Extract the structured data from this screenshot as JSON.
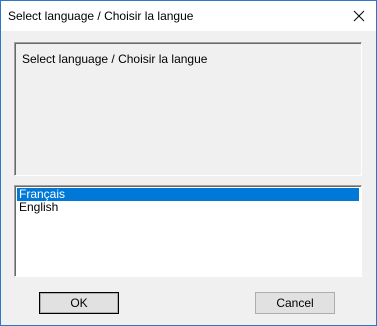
{
  "window": {
    "title": "Select language / Choisir la langue",
    "close_icon": "close-icon"
  },
  "message": {
    "text": "Select language / Choisir la langue"
  },
  "language_list": {
    "items": [
      {
        "label": "Français",
        "selected": true
      },
      {
        "label": "English",
        "selected": false
      }
    ]
  },
  "buttons": {
    "ok_label": "OK",
    "cancel_label": "Cancel"
  },
  "colors": {
    "selection": "#0078d7",
    "window_border": "#2b78c6",
    "dialog_background": "#f0f0f0"
  }
}
